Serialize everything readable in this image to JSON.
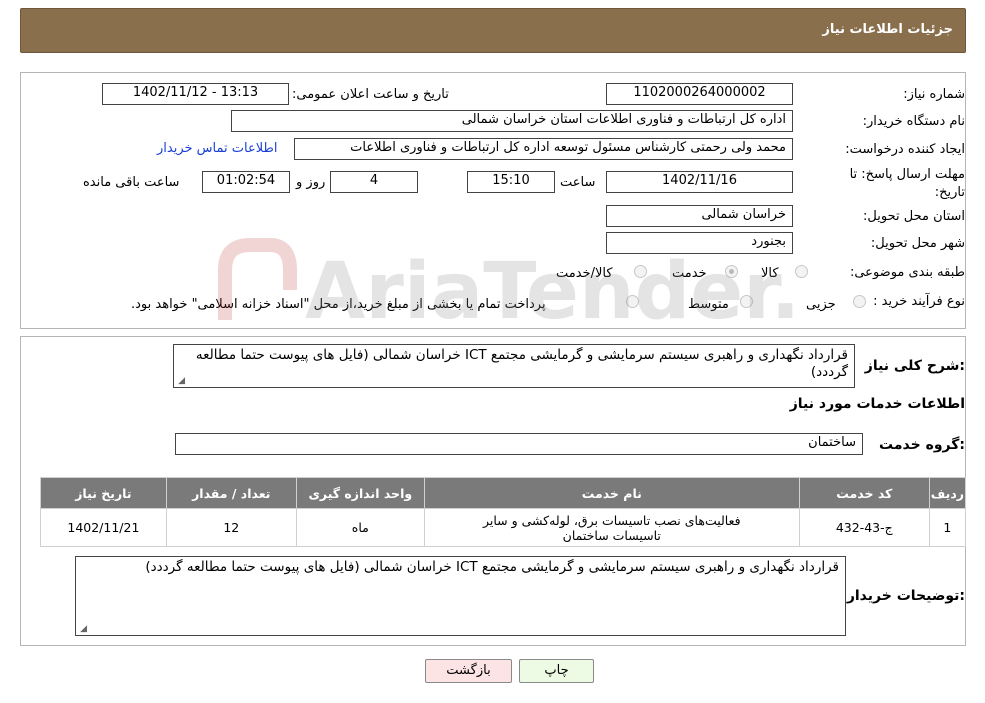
{
  "header": {
    "title": "جزئیات اطلاعات نیاز"
  },
  "info": {
    "need_number_label": "شماره نیاز:",
    "need_number": "1102000264000002",
    "announce_label": "تاریخ و ساعت اعلان عمومی:",
    "announce_value": "1402/11/12 - 13:13",
    "buyer_org_label": "نام دستگاه خریدار:",
    "buyer_org": "اداره کل ارتباطات و فناوری اطلاعات استان خراسان شمالی",
    "creator_label": "ایجاد کننده درخواست:",
    "creator": "محمد ولی  رحمتی کارشناس مسئول توسعه اداره کل ارتباطات و فناوری اطلاعات",
    "contact_link": "اطلاعات تماس خریدار",
    "deadline_label_line1": "مهلت ارسال پاسخ: تا",
    "deadline_label_line2": "تاریخ:",
    "deadline_date": "1402/11/16",
    "time_label": "ساعت",
    "deadline_time": "15:10",
    "days_value": "4",
    "days_label": "روز و",
    "remaining_time": "01:02:54",
    "remaining_label": "ساعت باقی مانده",
    "province_label": "استان محل تحویل:",
    "province": "خراسان شمالی",
    "city_label": "شهر محل تحویل:",
    "city": "بجنورد",
    "category_label": "طبقه بندی موضوعی:",
    "category_options": [
      {
        "label": "کالا",
        "checked": false
      },
      {
        "label": "خدمت",
        "checked": true
      },
      {
        "label": "کالا/خدمت",
        "checked": false
      }
    ],
    "process_label": "نوع فرآیند خرید :",
    "process_options": [
      {
        "label": "جزیی",
        "checked": false
      },
      {
        "label": "متوسط",
        "checked": false
      },
      {
        "label": "پرداخت تمام یا بخشی از مبلغ خرید،از محل \"اسناد خزانه اسلامی\" خواهد بود.",
        "checked": false
      }
    ]
  },
  "details": {
    "summary_label": "شرح کلی نیاز:",
    "summary": "قرارداد نگهداری و راهبری سیستم سرمایشی و گرمایشی مجتمع ICT خراسان شمالی (فایل های پیوست حتما مطالعه گرددد)",
    "services_heading": "اطلاعات خدمات مورد نیاز",
    "service_group_label": "گروه خدمت:",
    "service_group": "ساختمان",
    "table": {
      "headers": [
        "ردیف",
        "کد خدمت",
        "نام خدمت",
        "واحد اندازه گیری",
        "تعداد / مقدار",
        "تاریخ نیاز"
      ],
      "rows": [
        [
          "1",
          "ج-43-432",
          "فعالیت‌های نصب تاسیسات برق، لوله‌کشی و سایر تاسیسات ساختمان",
          "ماه",
          "12",
          "1402/11/21"
        ]
      ]
    },
    "buyer_notes_label": "توضیحات خریدار:",
    "buyer_notes": "قرارداد نگهداری و راهبری سیستم سرمایشی و گرمایشی مجتمع ICT خراسان شمالی (فایل های پیوست حتما مطالعه گرددد)"
  },
  "buttons": {
    "print": "چاپ",
    "back": "بازگشت"
  },
  "watermark": {
    "text": "AriaTender.neT"
  },
  "colors": {
    "header_bg": "#8a6f4d",
    "link": "#1a3fd6",
    "table_header": "#7a7a7a",
    "print_btn": "#eefbe4",
    "back_btn": "#fde4e4"
  }
}
